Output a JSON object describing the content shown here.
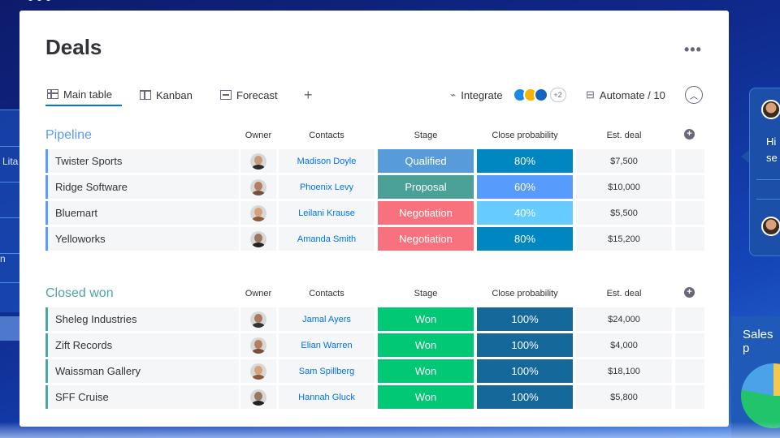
{
  "board": {
    "title": "Deals",
    "more_label": "•••"
  },
  "tabs": [
    {
      "label": "Main table",
      "icon": "table-icon"
    },
    {
      "label": "Kanban",
      "icon": "kanban-icon"
    },
    {
      "label": "Forecast",
      "icon": "forecast-icon"
    }
  ],
  "add_view_label": "+",
  "toolbar": {
    "integrate_label": "Integrate",
    "integrations_more": "+2",
    "automate_label": "Automate / 10",
    "collapse_icon": "chevron-up-icon"
  },
  "columns": {
    "owner": "Owner",
    "contacts": "Contacts",
    "stage": "Stage",
    "close_probability": "Close probability",
    "est_deal": "Est. deal"
  },
  "colors": {
    "accent": "#0073ea",
    "pipeline_group": "#579bfc",
    "closed_won_group": "#4ca6a0",
    "qualified": "#579bdb",
    "proposal": "#4ba097",
    "negotiation": "#f7727c",
    "won": "#00c875",
    "prob_80": "#0086c0",
    "prob_60": "#579bfc",
    "prob_40": "#66ccff",
    "prob_100": "#15689a"
  },
  "groups": [
    {
      "title": "Pipeline",
      "rows": [
        {
          "name": "Twister Sports",
          "contact": "Madison Doyle",
          "stage": "Qualified",
          "probability": "80%",
          "deal": "$7,500"
        },
        {
          "name": "Ridge Software",
          "contact": "Phoenix Levy",
          "stage": "Proposal",
          "probability": "60%",
          "deal": "$10,000"
        },
        {
          "name": "Bluemart",
          "contact": "Leilani Krause",
          "stage": "Negotiation",
          "probability": "40%",
          "deal": "$5,500"
        },
        {
          "name": "Yelloworks",
          "contact": "Amanda Smith",
          "stage": "Negotiation",
          "probability": "80%",
          "deal": "$15,200"
        }
      ]
    },
    {
      "title": "Closed won",
      "rows": [
        {
          "name": "Sheleg Industries",
          "contact": "Jamal Ayers",
          "stage": "Won",
          "probability": "100%",
          "deal": "$24,000"
        },
        {
          "name": "Zift Records",
          "contact": "Elian Warren",
          "stage": "Won",
          "probability": "100%",
          "deal": "$4,000"
        },
        {
          "name": "Waissman Gallery",
          "contact": "Sam Spillberg",
          "stage": "Won",
          "probability": "100%",
          "deal": "$18,100"
        },
        {
          "name": "SFF Cruise",
          "contact": "Hannah Gluck",
          "stage": "Won",
          "probability": "100%",
          "deal": "$5,800"
        }
      ]
    }
  ],
  "background": {
    "left_text": "Lita",
    "left_text2": "n",
    "chat_text": "Hi\nse",
    "sales_title": "Sales p"
  }
}
